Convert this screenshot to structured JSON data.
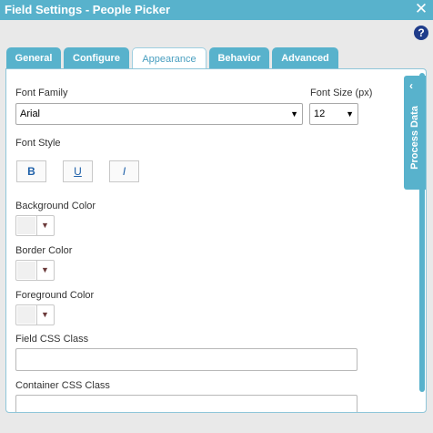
{
  "window": {
    "title": "Field Settings - People Picker",
    "close_glyph": "✕"
  },
  "help": {
    "glyph": "?"
  },
  "tabs": [
    {
      "label": "General",
      "active": false
    },
    {
      "label": "Configure",
      "active": false
    },
    {
      "label": "Appearance",
      "active": true
    },
    {
      "label": "Behavior",
      "active": false
    },
    {
      "label": "Advanced",
      "active": false
    }
  ],
  "form": {
    "font_family": {
      "label": "Font Family",
      "value": "Arial"
    },
    "font_size": {
      "label": "Font Size (px)",
      "value": "12"
    },
    "font_style": {
      "label": "Font Style",
      "bold": "B",
      "underline": "U",
      "italic": "I"
    },
    "background_color": {
      "label": "Background Color"
    },
    "border_color": {
      "label": "Border Color"
    },
    "foreground_color": {
      "label": "Foreground Color"
    },
    "field_css_class": {
      "label": "Field CSS Class",
      "value": ""
    },
    "container_css_class": {
      "label": "Container CSS Class",
      "value": ""
    }
  },
  "side_panel": {
    "label": "Process Data",
    "chevron": "‹"
  },
  "colors": {
    "accent": "#58b2cc",
    "help": "#1f3c8a",
    "style_text": "#1d5fa8"
  }
}
